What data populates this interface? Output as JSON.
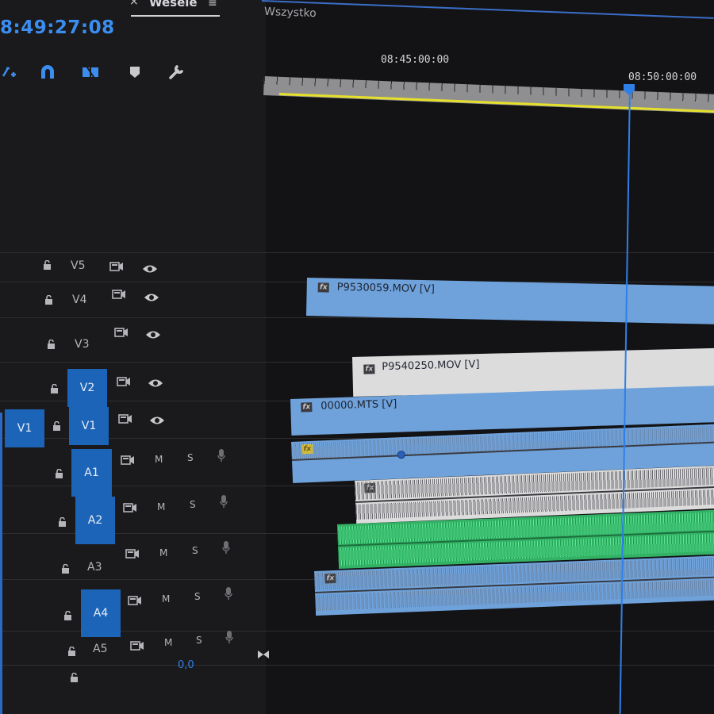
{
  "sequence_tab": {
    "close": "×",
    "title": "Wesele",
    "menu": "≡"
  },
  "filter": {
    "label": "Wszystko"
  },
  "timecode": "8:49:27:08",
  "ruler": {
    "labels": [
      "08:45:00:00",
      "08:50:00:00"
    ]
  },
  "video_tracks": [
    {
      "name": "V5"
    },
    {
      "name": "V4"
    },
    {
      "name": "V3"
    },
    {
      "name": "V2",
      "targeted": true
    },
    {
      "name": "V1",
      "targeted": true,
      "source_patch": "V1"
    }
  ],
  "audio_tracks": [
    {
      "name": "A1",
      "targeted": true,
      "mute": "M",
      "solo": "S"
    },
    {
      "name": "A2",
      "targeted": true,
      "mute": "M",
      "solo": "S"
    },
    {
      "name": "A3",
      "targeted": false,
      "mute": "M",
      "solo": "S"
    },
    {
      "name": "A4",
      "targeted": true,
      "mute": "M",
      "solo": "S"
    },
    {
      "name": "A5",
      "targeted": false,
      "mute": "M",
      "solo": "S"
    }
  ],
  "clips": {
    "v4": "P9530059.MOV [V]",
    "v2": "P9540250.MOV [V]",
    "v1": "00000.MTS [V]",
    "fx_label": "fx"
  },
  "master": {
    "value": "0,0"
  },
  "colors": {
    "accent": "#2f7fe8",
    "clip_video_blue": "#6fa2db",
    "clip_video_white": "#dcdcdc",
    "clip_audio_green": "#33b266",
    "work_area": "#e5e02a",
    "track_target": "#1c64b7"
  }
}
